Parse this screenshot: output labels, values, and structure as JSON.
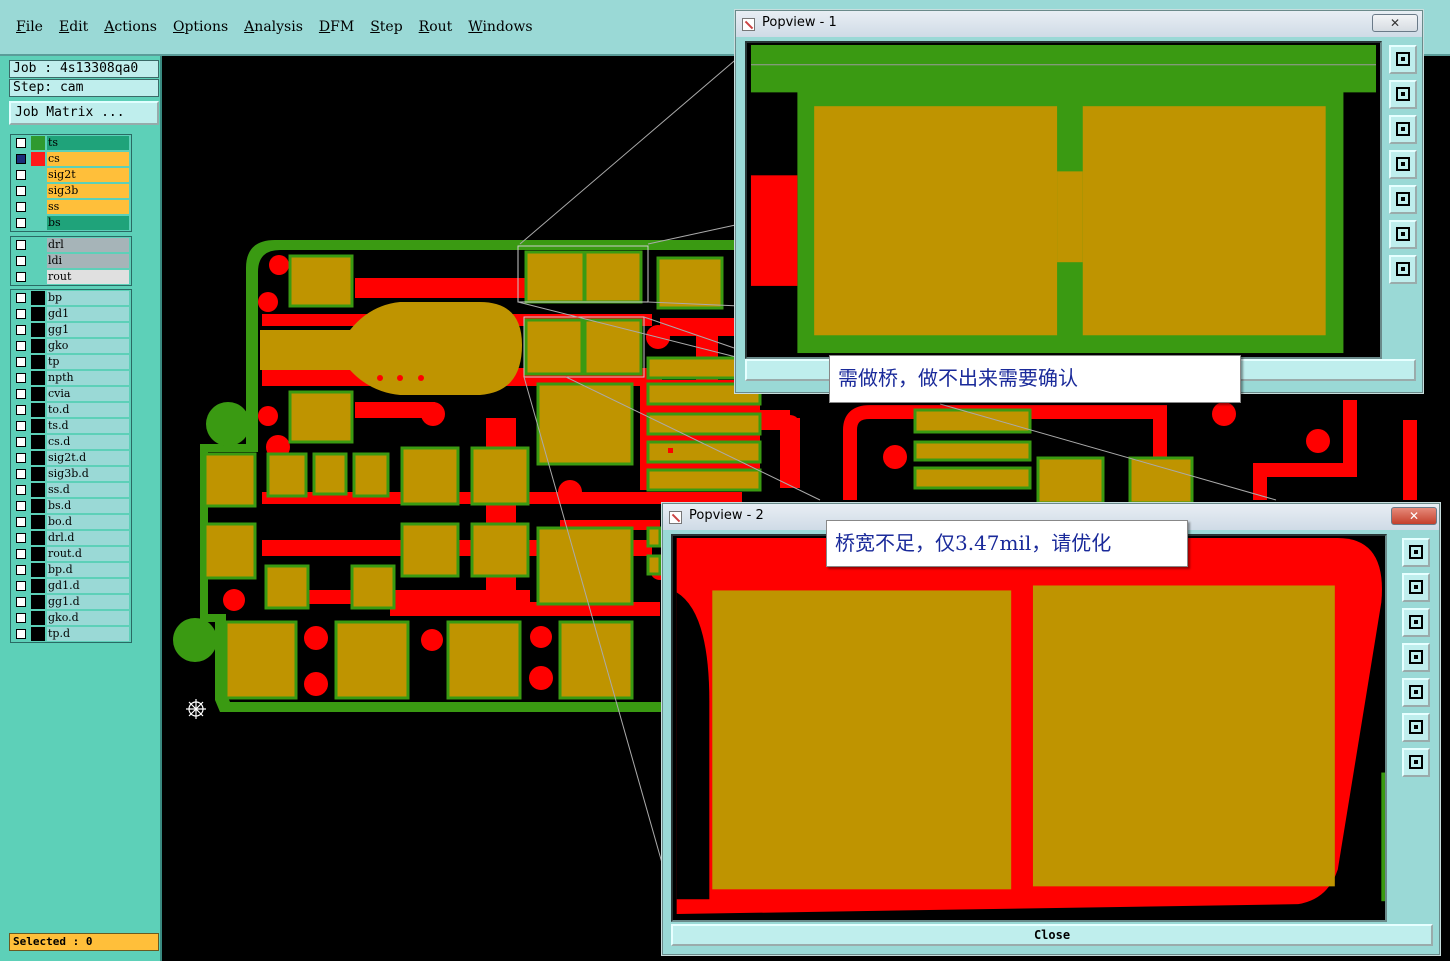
{
  "menubar": {
    "items": [
      "File",
      "Edit",
      "Actions",
      "Options",
      "Analysis",
      "DFM",
      "Step",
      "Rout",
      "Windows"
    ]
  },
  "job": {
    "job_line": "Job : 4s13308qa0",
    "step_line": "Step: cam",
    "matrix_button": "Job Matrix ..."
  },
  "layers": {
    "group1": [
      {
        "name": "ts",
        "color": "#1fa37a",
        "swatch": "#2f9a2f",
        "checked": false
      },
      {
        "name": "cs",
        "color": "#ffbf3a",
        "swatch": "#ff1a1a",
        "checked": true
      },
      {
        "name": "sig2t",
        "color": "#ffbf3a",
        "swatch": "#5dd0b8",
        "checked": false
      },
      {
        "name": "sig3b",
        "color": "#ffbf3a",
        "swatch": "#5dd0b8",
        "checked": false
      },
      {
        "name": "ss",
        "color": "#ffbf3a",
        "swatch": "#5dd0b8",
        "checked": false
      },
      {
        "name": "bs",
        "color": "#1fa37a",
        "swatch": "#5dd0b8",
        "checked": false
      }
    ],
    "group2": [
      {
        "name": "drl",
        "color": "#a6b4b8",
        "swatch": "#5dd0b8",
        "checked": false
      },
      {
        "name": "ldi",
        "color": "#a6b4b8",
        "swatch": "#5dd0b8",
        "checked": false
      },
      {
        "name": "rout",
        "color": "#e0e0e0",
        "swatch": "#5dd0b8",
        "checked": false
      }
    ],
    "group3": [
      {
        "name": "bp"
      },
      {
        "name": "gd1"
      },
      {
        "name": "gg1"
      },
      {
        "name": "gko"
      },
      {
        "name": "tp"
      },
      {
        "name": "npth"
      },
      {
        "name": "cvia"
      },
      {
        "name": "to.d"
      },
      {
        "name": "ts.d"
      },
      {
        "name": "cs.d"
      },
      {
        "name": "sig2t.d"
      },
      {
        "name": "sig3b.d"
      },
      {
        "name": "ss.d"
      },
      {
        "name": "bs.d"
      },
      {
        "name": "bo.d"
      },
      {
        "name": "drl.d"
      },
      {
        "name": "rout.d"
      },
      {
        "name": "bp.d"
      },
      {
        "name": "gd1.d"
      },
      {
        "name": "gg1.d"
      },
      {
        "name": "gko.d"
      },
      {
        "name": "tp.d"
      }
    ]
  },
  "status": {
    "selected": "Selected : 0"
  },
  "popview1": {
    "title": "Popview - 1",
    "close_glyph": "✕",
    "annotation": "需做桥，做不出来需要确认"
  },
  "popview2": {
    "title": "Popview - 2",
    "close_glyph": "✕",
    "close_label": "Close",
    "annotation": "桥宽不足，仅3.47mil，请优化"
  },
  "colors": {
    "pad": "#bf9400",
    "trace": "#ff0000",
    "mask": "#3a9a12",
    "panel": "#5dd0b8",
    "menubar": "#9ad9d6",
    "annotation_text": "#1a2a9a"
  },
  "icons": {
    "toolbar": [
      "zoom-window-icon",
      "pan-up-icon",
      "pan-down-icon",
      "pan-left-icon",
      "pan-right-icon",
      "zoom-fit-icon",
      "zoom-center-icon"
    ]
  }
}
